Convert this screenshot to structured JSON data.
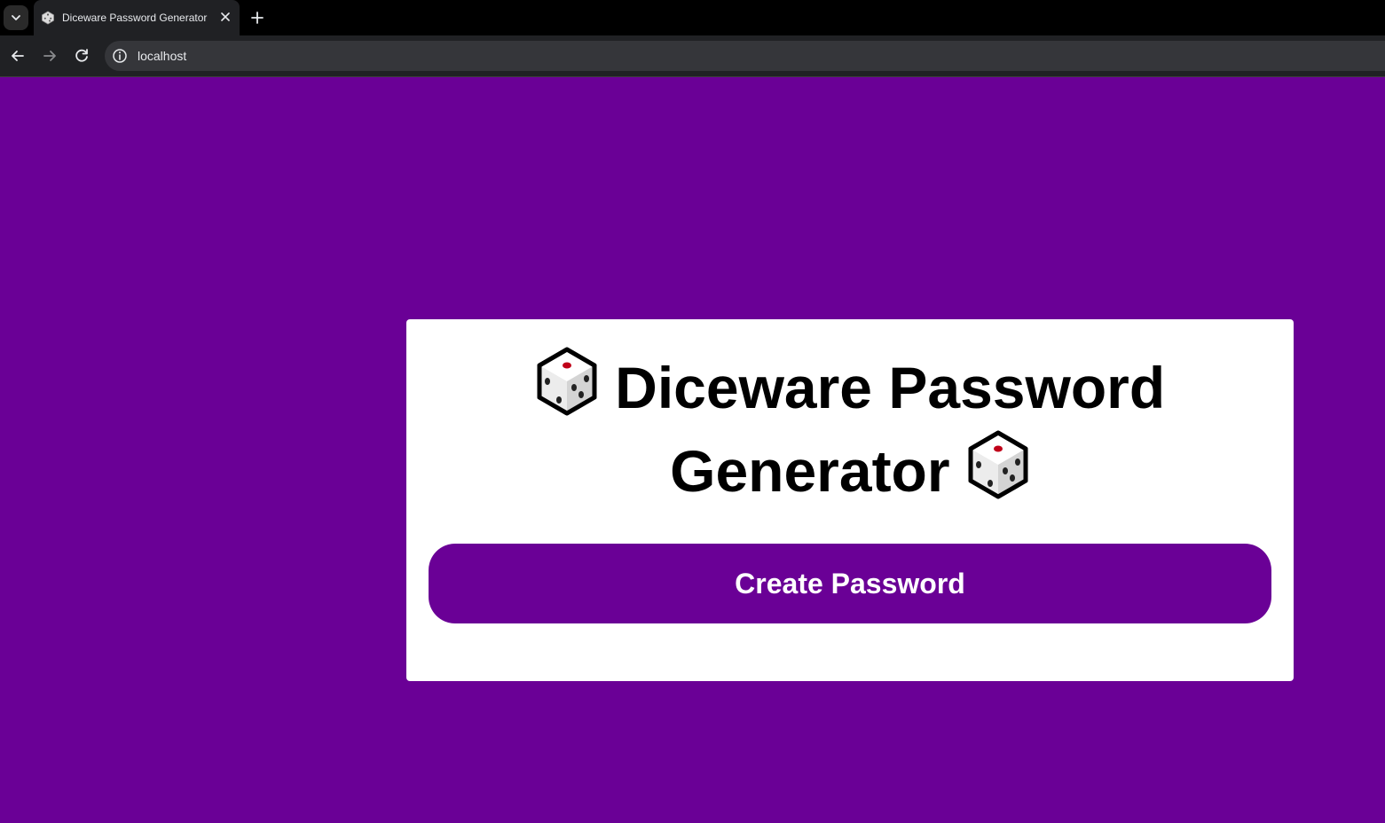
{
  "browser": {
    "tab_title": "Diceware Password Generator",
    "url": "localhost",
    "icons": {
      "tab_menu": "chevron-down-icon",
      "favicon": "dice-favicon-icon",
      "close": "close-icon",
      "new_tab": "plus-icon",
      "back": "back-arrow-icon",
      "forward": "forward-arrow-icon",
      "reload": "reload-icon",
      "site_info": "info-icon"
    }
  },
  "page": {
    "background_color": "#6a0096",
    "card_color": "#ffffff",
    "heading_line1": "Diceware Password",
    "heading_line2": "Generator",
    "heading_emoji": "game-die",
    "button_label": "Create Password",
    "button_color": "#6a0096"
  }
}
